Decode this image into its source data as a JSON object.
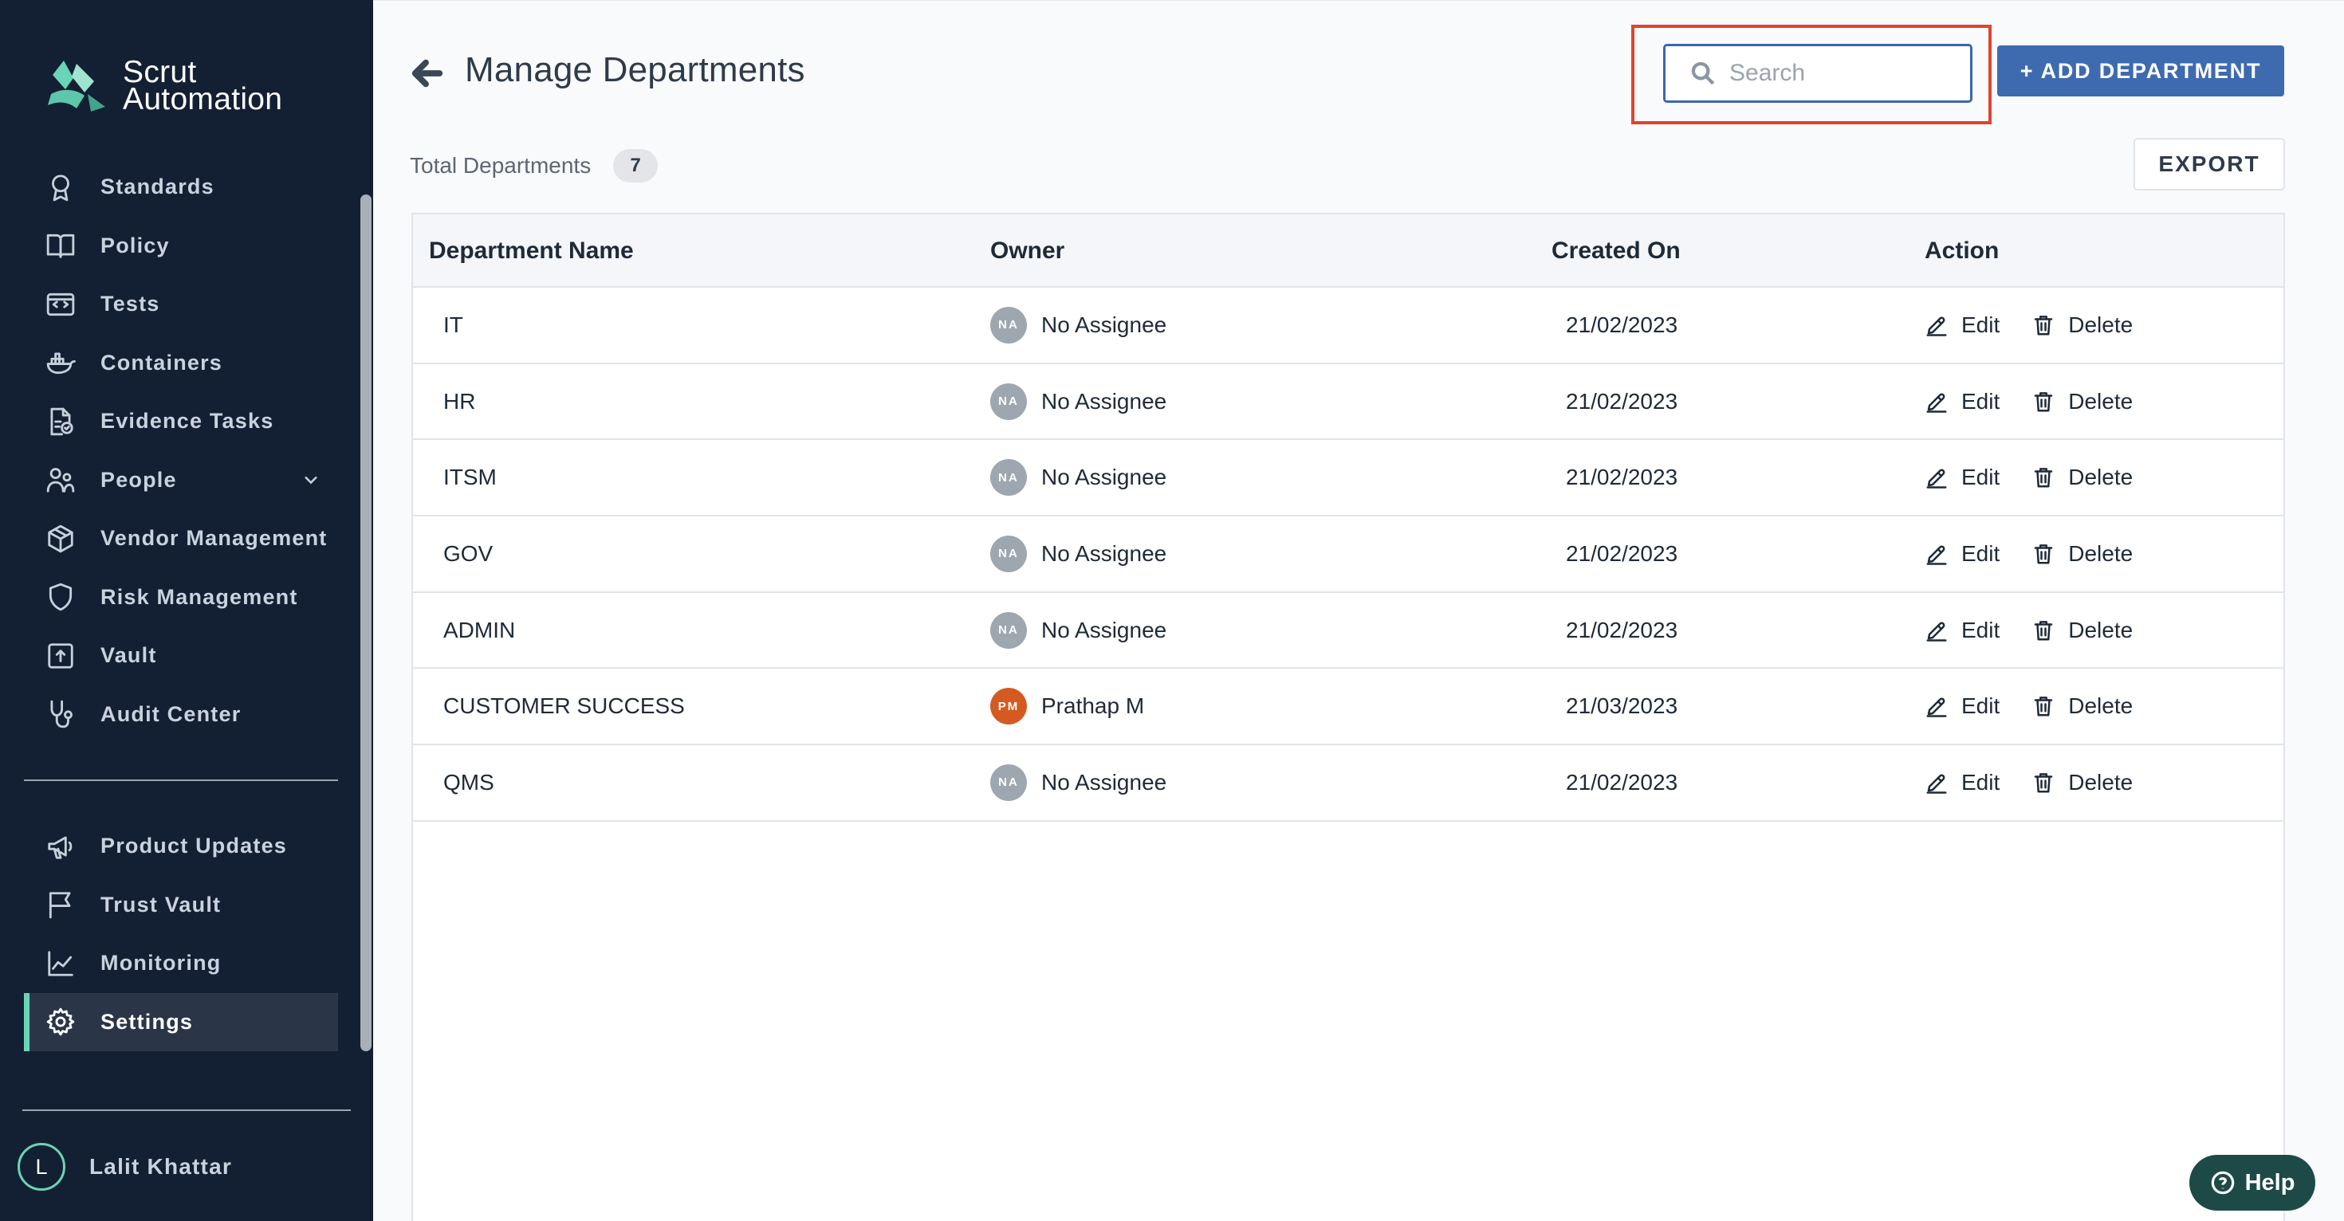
{
  "brand": {
    "line1": "Scrut",
    "line2": "Automation",
    "accent": "#6ad4b7",
    "sidebar_bg": "#132033"
  },
  "sidebar": {
    "items": [
      {
        "label": "Standards",
        "icon": "award-icon"
      },
      {
        "label": "Policy",
        "icon": "book-icon"
      },
      {
        "label": "Tests",
        "icon": "code-icon"
      },
      {
        "label": "Containers",
        "icon": "containers-icon"
      },
      {
        "label": "Evidence Tasks",
        "icon": "evidence-icon"
      },
      {
        "label": "People",
        "icon": "people-icon"
      },
      {
        "label": "Vendor Management",
        "icon": "cube-icon"
      },
      {
        "label": "Risk Management",
        "icon": "shield-icon"
      },
      {
        "label": "Vault",
        "icon": "vault-icon"
      },
      {
        "label": "Audit Center",
        "icon": "stethoscope-icon"
      }
    ],
    "secondary": [
      {
        "label": "Product Updates",
        "icon": "megaphone-icon"
      },
      {
        "label": "Trust Vault",
        "icon": "flag-icon"
      },
      {
        "label": "Monitoring",
        "icon": "chart-icon"
      },
      {
        "label": "Settings",
        "icon": "gear-icon",
        "active": true
      }
    ],
    "user": {
      "initial": "L",
      "name": "Lalit Khattar"
    }
  },
  "header": {
    "title": "Manage Departments",
    "search_placeholder": "Search",
    "add_label": "+ ADD DEPARTMENT",
    "total_label": "Total Departments",
    "total_count": "7",
    "export_label": "EXPORT"
  },
  "table": {
    "columns": [
      "Department Name",
      "Owner",
      "Created On",
      "Action"
    ],
    "edit_label": "Edit",
    "delete_label": "Delete",
    "rows": [
      {
        "name": "IT",
        "owner_initials": "NA",
        "owner": "No Assignee",
        "created": "21/02/2023"
      },
      {
        "name": "HR",
        "owner_initials": "NA",
        "owner": "No Assignee",
        "created": "21/02/2023"
      },
      {
        "name": "ITSM",
        "owner_initials": "NA",
        "owner": "No Assignee",
        "created": "21/02/2023"
      },
      {
        "name": "GOV",
        "owner_initials": "NA",
        "owner": "No Assignee",
        "created": "21/02/2023"
      },
      {
        "name": "ADMIN",
        "owner_initials": "NA",
        "owner": "No Assignee",
        "created": "21/02/2023"
      },
      {
        "name": "CUSTOMER SUCCESS",
        "owner_initials": "PM",
        "owner": "Prathap M",
        "created": "21/03/2023"
      },
      {
        "name": "QMS",
        "owner_initials": "NA",
        "owner": "No Assignee",
        "created": "21/02/2023"
      }
    ]
  },
  "help": {
    "label": "Help"
  }
}
